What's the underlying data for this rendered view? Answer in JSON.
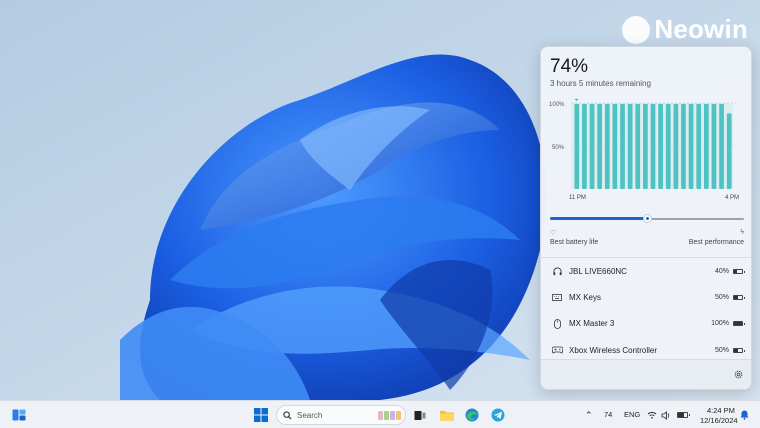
{
  "watermark": {
    "brand": "Neowin"
  },
  "battery_flyout": {
    "percent": "74%",
    "remaining": "3 hours 5 minutes remaining",
    "chart_data": {
      "type": "bar",
      "title": "",
      "y_ticks": [
        "100%",
        "50%"
      ],
      "ylim": [
        0,
        100
      ],
      "x_tick_labels": [
        "11 PM",
        "4 PM"
      ],
      "values": [
        99,
        99,
        99,
        99,
        99,
        99,
        99,
        99,
        99,
        99,
        99,
        99,
        99,
        99,
        99,
        99,
        99,
        99,
        99,
        99,
        88
      ],
      "bar_color": "#4fc3c3"
    },
    "power_mode": {
      "level": 0.5,
      "left_label": "Best battery life",
      "right_label": "Best performance"
    },
    "devices": [
      {
        "name": "JBL LIVE660NC",
        "percent": "40%",
        "level": 0.4,
        "icon": "headphones-icon"
      },
      {
        "name": "MX Keys",
        "percent": "50%",
        "level": 0.5,
        "icon": "keyboard-icon"
      },
      {
        "name": "MX Master 3",
        "percent": "100%",
        "level": 1.0,
        "icon": "mouse-icon"
      },
      {
        "name": "Xbox Wireless Controller",
        "percent": "50%",
        "level": 0.5,
        "icon": "gamepad-icon"
      }
    ],
    "footer": {
      "settings_icon": "gear-icon"
    }
  },
  "taskbar": {
    "search_placeholder": "Search",
    "tray": {
      "battery_percent": "74",
      "language": "ENG",
      "time": "4:24 PM",
      "date": "12/16/2024"
    }
  },
  "colors": {
    "accent": "#1a63d1",
    "chart_bar": "#4fc3c3",
    "wallpaper_blue": "#1e63e6"
  }
}
